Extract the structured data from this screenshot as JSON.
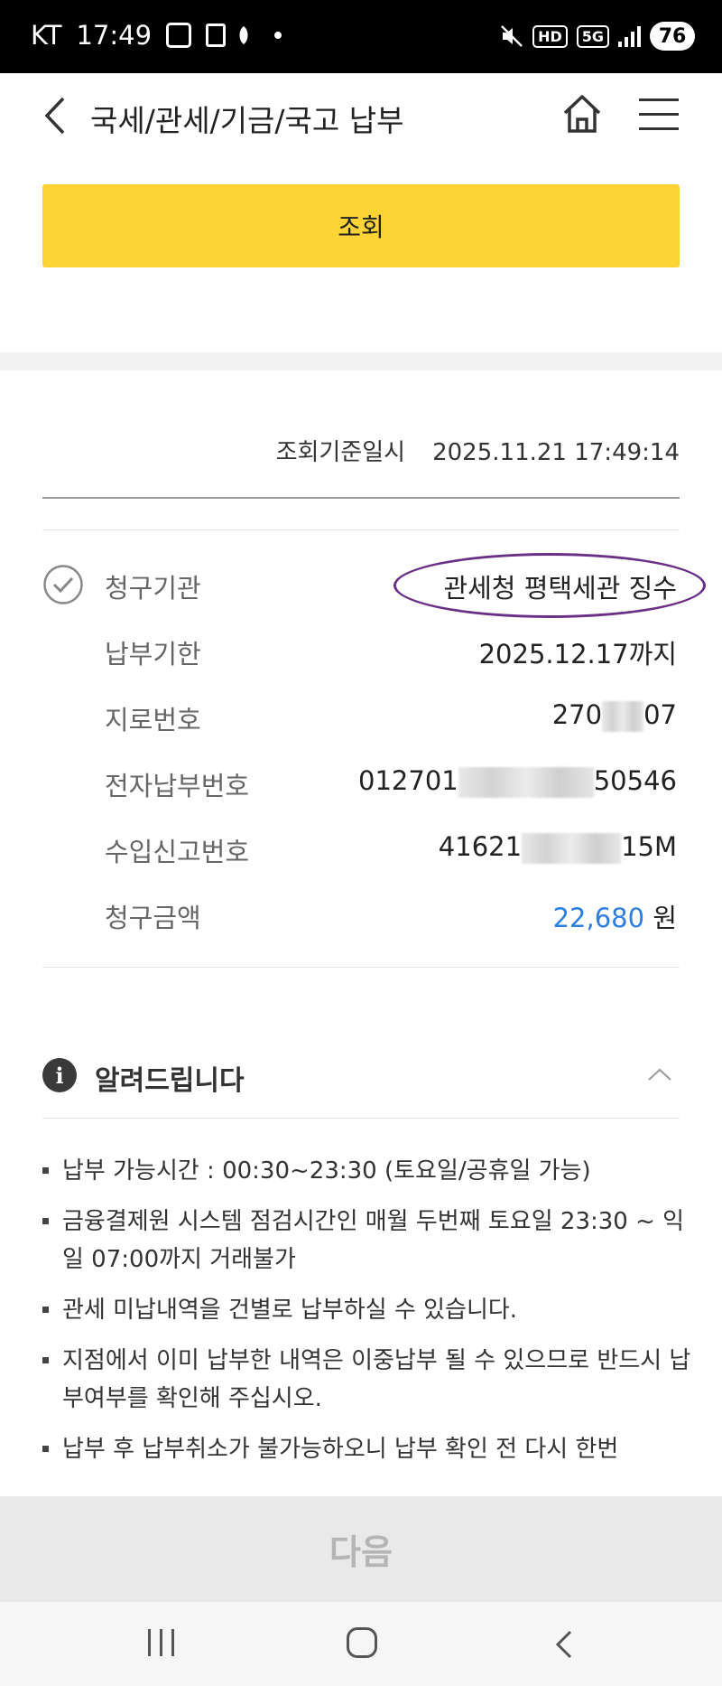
{
  "status_bar": {
    "carrier": "KT",
    "time": "17:49",
    "hd_badge": "HD",
    "network": "5G",
    "battery": "76"
  },
  "header": {
    "title": "국세/관세/기금/국고 납부",
    "icons": [
      "back-icon",
      "home-icon",
      "menu-icon"
    ]
  },
  "inquiry_button": "조회",
  "reference": {
    "label": "조회기준일시",
    "value": "2025.11.21 17:49:14"
  },
  "bill": {
    "rows": [
      {
        "label": "청구기관",
        "value": "관세청 평택세관 징수"
      },
      {
        "label": "납부기한",
        "value": "2025.12.17까지"
      },
      {
        "label": "지로번호",
        "value_prefix": "270",
        "value_suffix": "07"
      },
      {
        "label": "전자납부번호",
        "value_prefix": "012701",
        "value_suffix": "50546"
      },
      {
        "label": "수입신고번호",
        "value_prefix": "41621",
        "value_suffix": "15M"
      },
      {
        "label": "청구금액",
        "amount": "22,680",
        "unit": "원"
      }
    ],
    "amount_color": "#2c7fe0",
    "annotation_color": "#6a2f86"
  },
  "notice": {
    "title": "알려드립니다",
    "items": [
      "납부 가능시간 : 00:30~23:30 (토요일/공휴일 가능)",
      "금융결제원 시스템 점검시간인 매월 두번째 토요일 23:30 ~ 익일 07:00까지 거래불가",
      "관세 미납내역을 건별로 납부하실 수 있습니다.",
      "지점에서 이미 납부한 내역은 이중납부 될 수 있으므로 반드시 납부여부를 확인해 주십시오.",
      "납부 후 납부취소가 불가능하오니 납부 확인 전 다시 한번"
    ]
  },
  "next_button": "다음",
  "accent_color": "#fdd335"
}
